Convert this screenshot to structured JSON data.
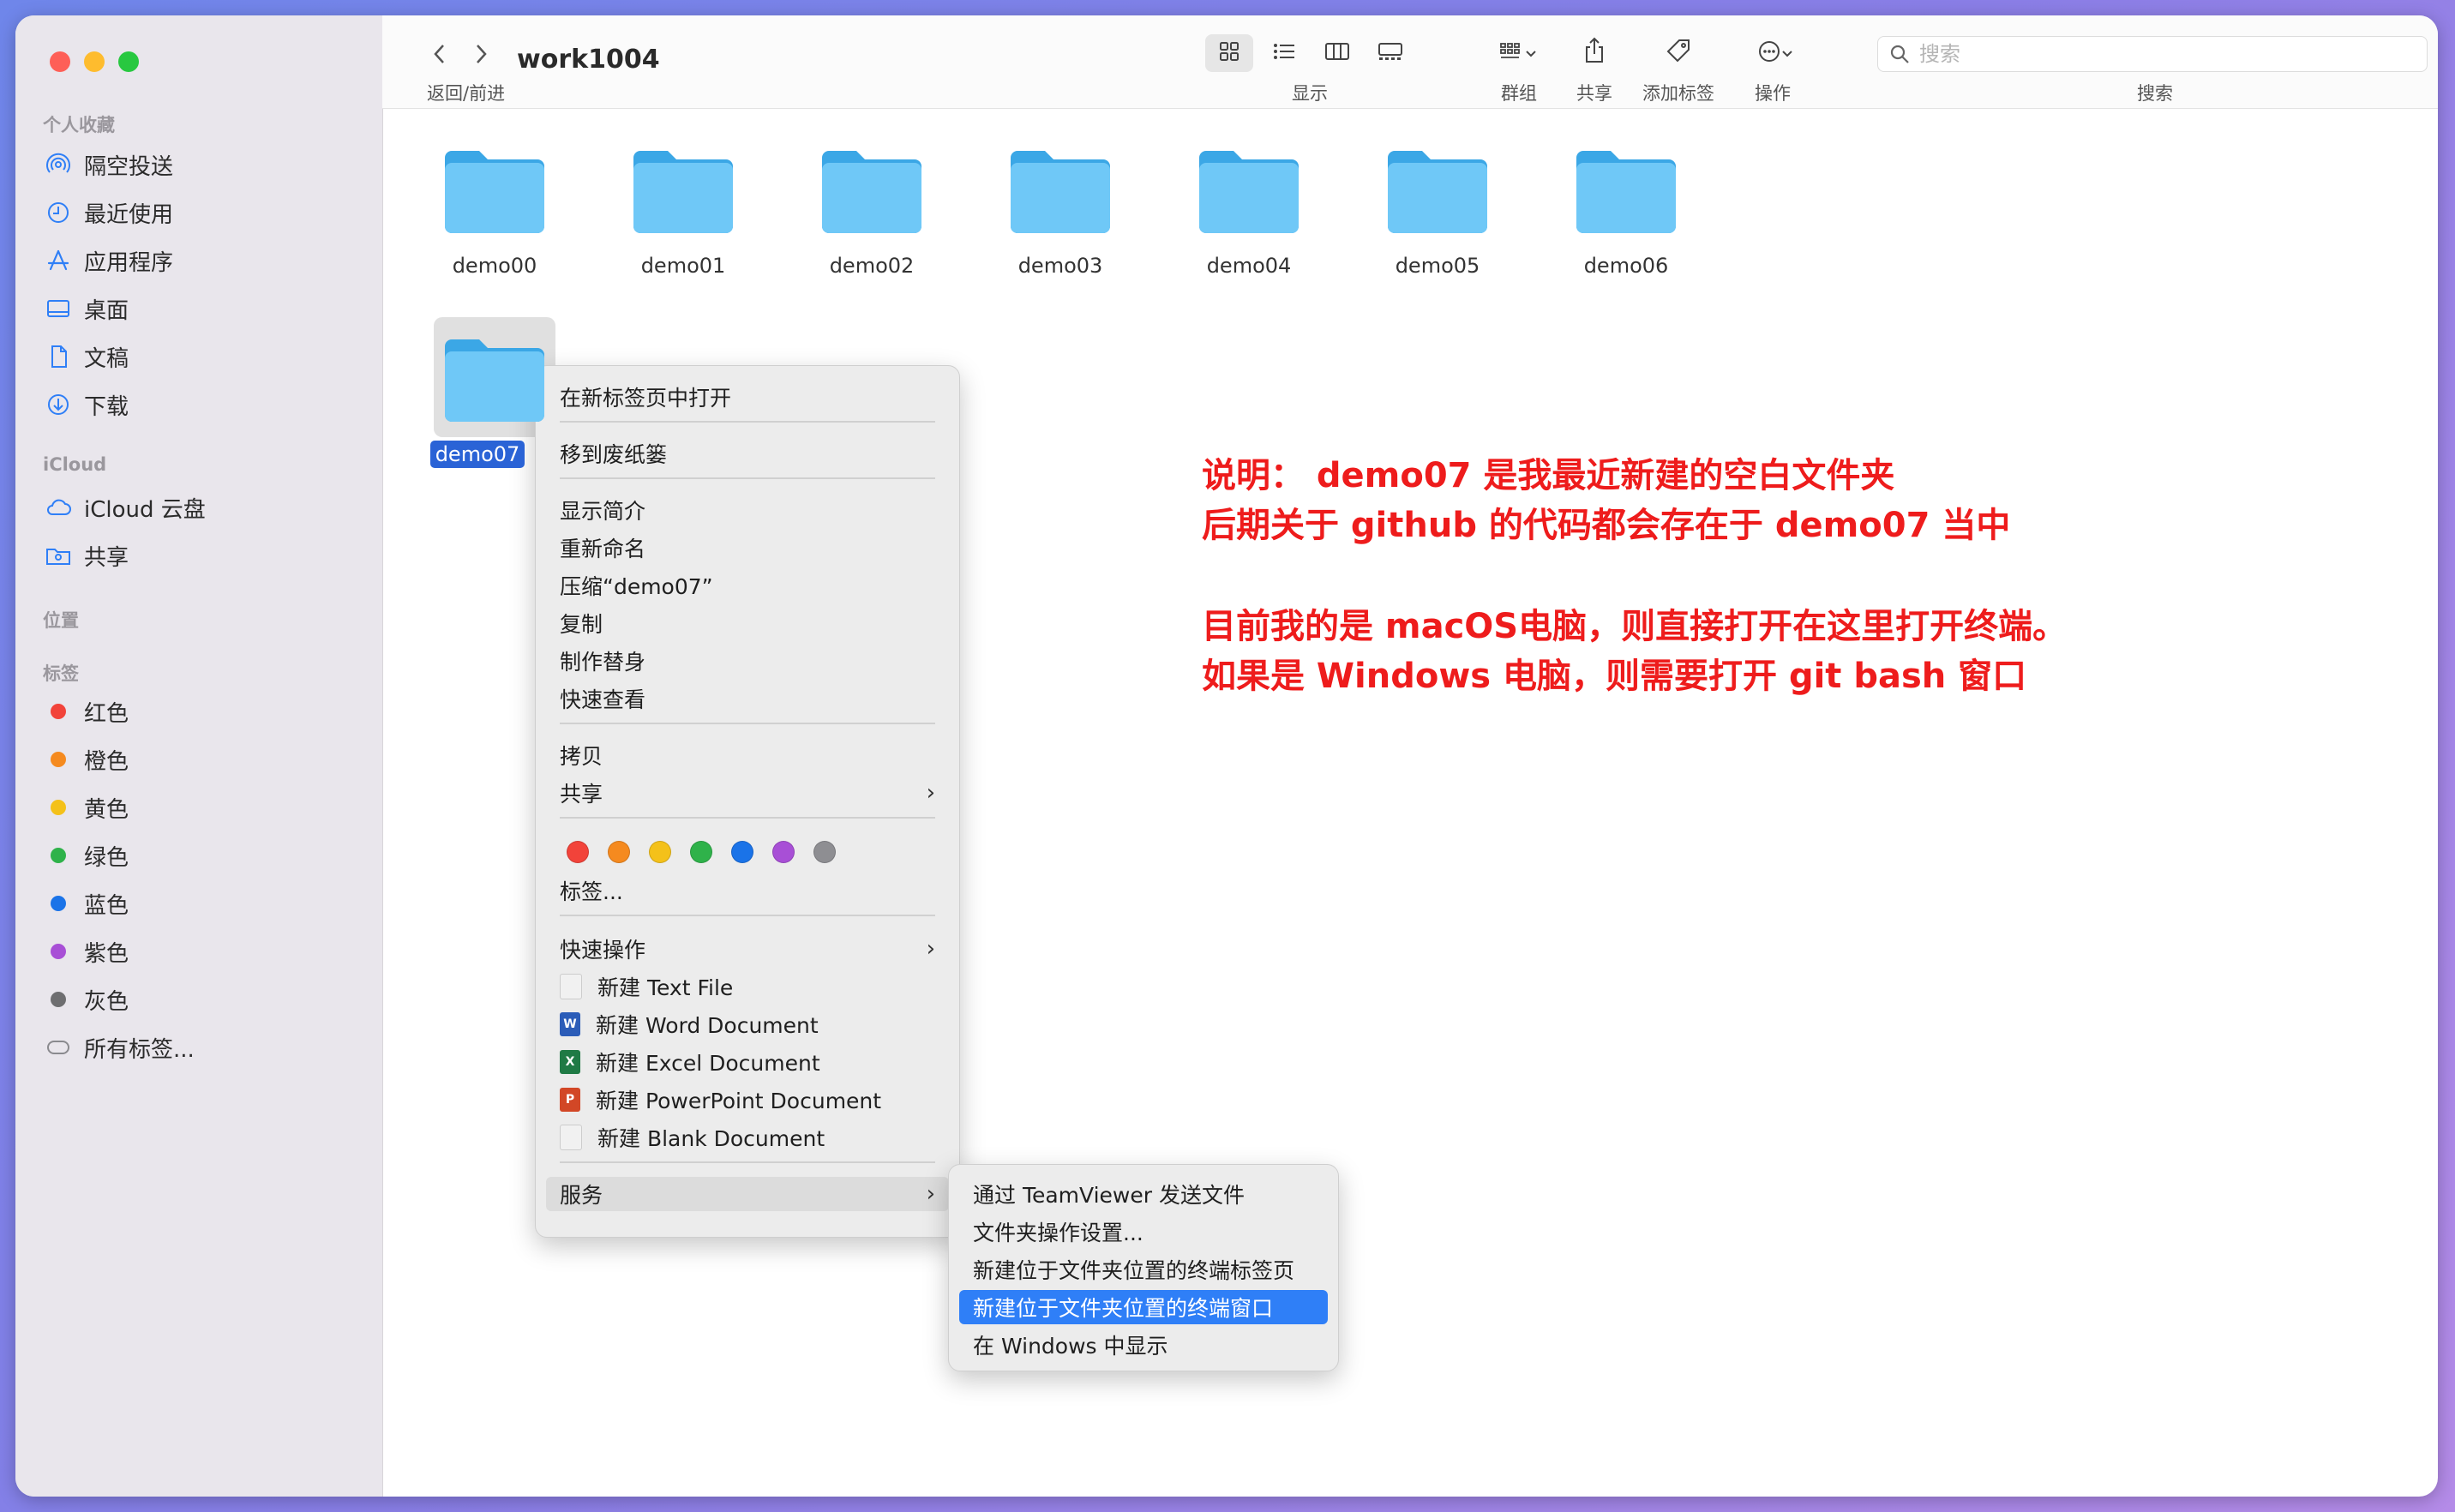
{
  "window": {
    "title": "work1004"
  },
  "sidebar": {
    "sections": [
      {
        "label": "个人收藏",
        "items": [
          {
            "icon": "airdrop-icon",
            "label": "隔空投送"
          },
          {
            "icon": "clock-icon",
            "label": "最近使用"
          },
          {
            "icon": "apps-icon",
            "label": "应用程序"
          },
          {
            "icon": "desktop-icon",
            "label": "桌面"
          },
          {
            "icon": "document-icon",
            "label": "文稿"
          },
          {
            "icon": "download-icon",
            "label": "下载"
          }
        ]
      },
      {
        "label": "iCloud",
        "items": [
          {
            "icon": "cloud-icon",
            "label": "iCloud 云盘"
          },
          {
            "icon": "shared-folder-icon",
            "label": "共享"
          }
        ]
      },
      {
        "label": "位置",
        "items": []
      },
      {
        "label": "标签",
        "items": [
          {
            "color": "#f2433a",
            "label": "红色"
          },
          {
            "color": "#f58a1f",
            "label": "橙色"
          },
          {
            "color": "#f4c11a",
            "label": "黄色"
          },
          {
            "color": "#2fb24a",
            "label": "绿色"
          },
          {
            "color": "#1a73e8",
            "label": "蓝色"
          },
          {
            "color": "#a84fd6",
            "label": "紫色"
          },
          {
            "color": "#6e6e70",
            "label": "灰色"
          },
          {
            "icon": "all-tags-icon",
            "label": "所有标签..."
          }
        ]
      }
    ]
  },
  "toolbar": {
    "nav_label": "返回/前进",
    "view_label": "显示",
    "group_label": "群组",
    "share_label": "共享",
    "tag_label": "添加标签",
    "action_label": "操作",
    "search_label": "搜索",
    "search_placeholder": "搜索"
  },
  "folders": [
    "demo00",
    "demo01",
    "demo02",
    "demo03",
    "demo04",
    "demo05",
    "demo06",
    "demo07"
  ],
  "context_menu": {
    "open_new_tab": "在新标签页中打开",
    "move_trash": "移到废纸篓",
    "get_info": "显示简介",
    "rename": "重新命名",
    "compress": "压缩“demo07”",
    "duplicate": "复制",
    "make_alias": "制作替身",
    "quick_look": "快速查看",
    "copy": "拷贝",
    "share": "共享",
    "tag_colors": [
      "#f2433a",
      "#f58a1f",
      "#f4c11a",
      "#2fb24a",
      "#1a73e8",
      "#a84fd6",
      "#8e8e92"
    ],
    "tags": "标签...",
    "quick_actions": "快速操作",
    "new_text": "新建 Text File",
    "new_word": "新建 Word Document",
    "new_excel": "新建 Excel Document",
    "new_ppt": "新建 PowerPoint Document",
    "new_blank": "新建 Blank Document",
    "services": "服务"
  },
  "services_menu": {
    "teamviewer": "通过 TeamViewer 发送文件",
    "folder_actions": "文件夹操作设置...",
    "new_terminal_tab": "新建位于文件夹位置的终端标签页",
    "new_terminal_window": "新建位于文件夹位置的终端窗口",
    "show_in_windows": "在 Windows 中显示"
  },
  "annotation": {
    "line1": "说明： demo07 是我最近新建的空白文件夹",
    "line2": "后期关于 github 的代码都会存在于 demo07 当中",
    "line3": "目前我的是 macOS电脑，则直接打开在这里打开终端。",
    "line4": "如果是 Windows 电脑，则需要打开 git  bash 窗口"
  },
  "colors": {
    "accent": "#2f7ff7",
    "annotation": "#ee1c1c",
    "folder": "#4fb6f2"
  }
}
